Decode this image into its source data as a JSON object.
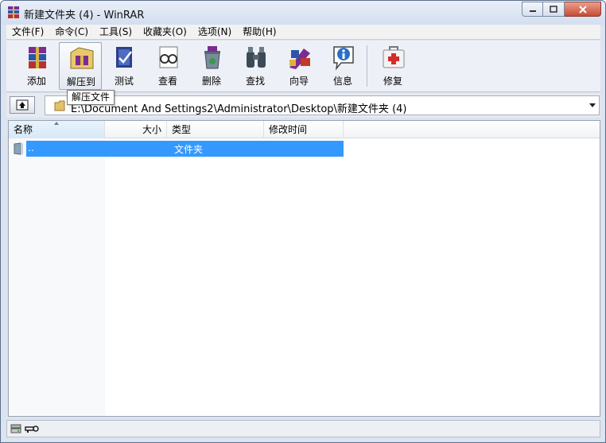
{
  "window": {
    "title": "新建文件夹 (4) - WinRAR"
  },
  "menu": [
    "文件(F)",
    "命令(C)",
    "工具(S)",
    "收藏夹(O)",
    "选项(N)",
    "帮助(H)"
  ],
  "toolbar": {
    "add": "添加",
    "extract": "解压到",
    "test": "测试",
    "view": "查看",
    "delete": "删除",
    "find": "查找",
    "wizard": "向导",
    "info": "信息",
    "repair": "修复"
  },
  "tooltip": "解压文件",
  "address": {
    "path": "E:\\Document And Settings2\\Administrator\\Desktop\\新建文件夹 (4)"
  },
  "columns": {
    "name": "名称",
    "size": "大小",
    "type": "类型",
    "modified": "修改时间"
  },
  "files": [
    {
      "name": "..",
      "size": "",
      "type": "文件夹",
      "modified": ""
    }
  ],
  "icons": [
    "winrar-app-icon",
    "minimize-icon",
    "maximize-icon",
    "close-icon",
    "add-icon",
    "extract-icon",
    "test-icon",
    "view-icon",
    "delete-icon",
    "find-icon",
    "wizard-icon",
    "info-icon",
    "repair-icon",
    "up-folder-icon",
    "folder-icon",
    "drive-icon",
    "key-icon"
  ],
  "colors": {
    "selection": "#3399ff",
    "close_button": "#c84a33"
  }
}
